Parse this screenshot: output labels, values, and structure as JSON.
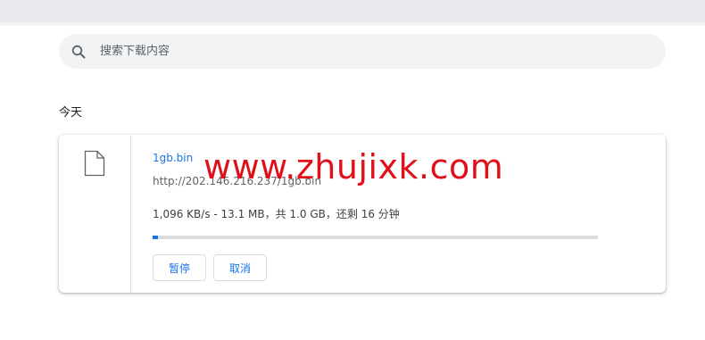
{
  "search": {
    "placeholder": "搜索下载内容"
  },
  "section": {
    "title": "今天"
  },
  "download": {
    "file_name": "1gb.bin",
    "url": "http://202.146.216.237/1gb.bin",
    "progress_text": "1,096 KB/s - 13.1 MB，共 1.0 GB，还剩 16 分钟",
    "progress_fraction": 0.0128,
    "pause_label": "暂停",
    "cancel_label": "取消"
  },
  "watermark": {
    "text": "www.zhujixk.com"
  },
  "colors": {
    "accent": "#1a73e8",
    "watermark": "#e0101a",
    "track": "#dadce0"
  },
  "icons": {
    "search": "search-icon",
    "file": "file-icon"
  }
}
